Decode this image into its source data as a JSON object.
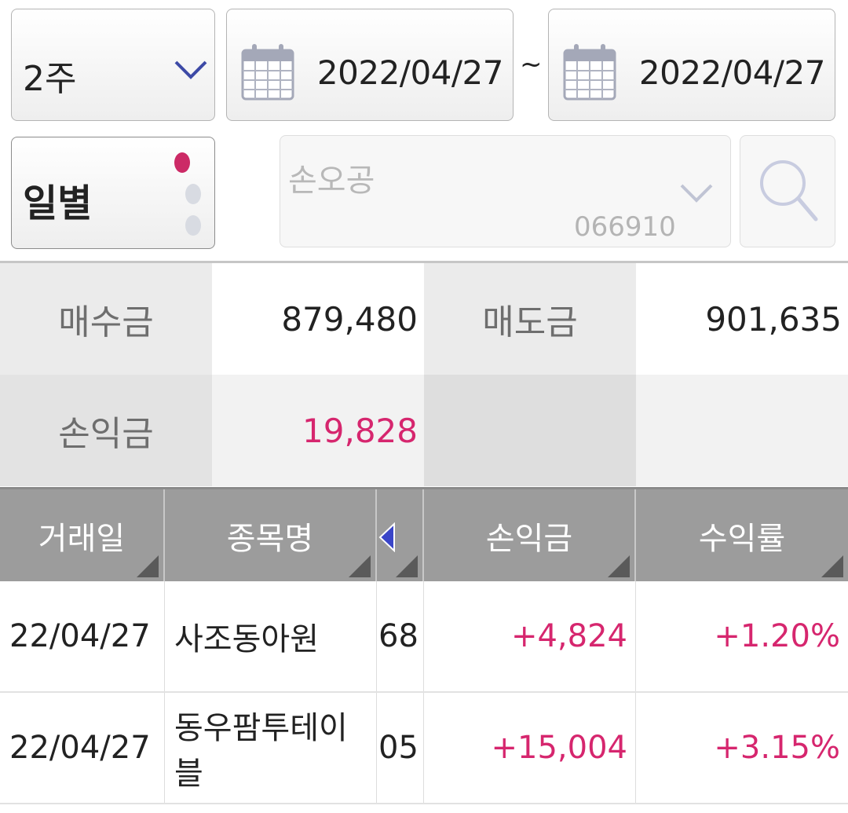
{
  "filters": {
    "period": "2주",
    "start_date": "2022/04/27",
    "date_separator": "~",
    "end_date": "2022/04/27",
    "mode": "일별",
    "stock_name_placeholder": "손오공",
    "stock_code": "066910",
    "page_indicator": {
      "count": 3,
      "active": 1
    }
  },
  "summary": {
    "buy_label": "매수금",
    "buy_value": "879,480",
    "sell_label": "매도금",
    "sell_value": "901,635",
    "profit_label": "손익금",
    "profit_value": "19,828"
  },
  "table": {
    "headers": [
      "거래일",
      "종목명",
      "손익금",
      "수익률"
    ],
    "rows": [
      {
        "date": "22/04/27",
        "name": "사조동아원",
        "code_frag": "68",
        "profit": "+4,824",
        "rate": "+1.20%"
      },
      {
        "date": "22/04/27",
        "name": "동우팜투테이블",
        "code_frag": "05",
        "profit": "+15,004",
        "rate": "+3.15%"
      }
    ]
  },
  "colors": {
    "accent_positive": "#d6266e",
    "header_bg": "#9c9c9c",
    "label_bg": "#ebebeb",
    "icon_blue": "#3d4aa6"
  },
  "icons": [
    "chevron-down-icon",
    "calendar-icon",
    "search-icon",
    "left-triangle-icon",
    "sort-corner-icon"
  ]
}
